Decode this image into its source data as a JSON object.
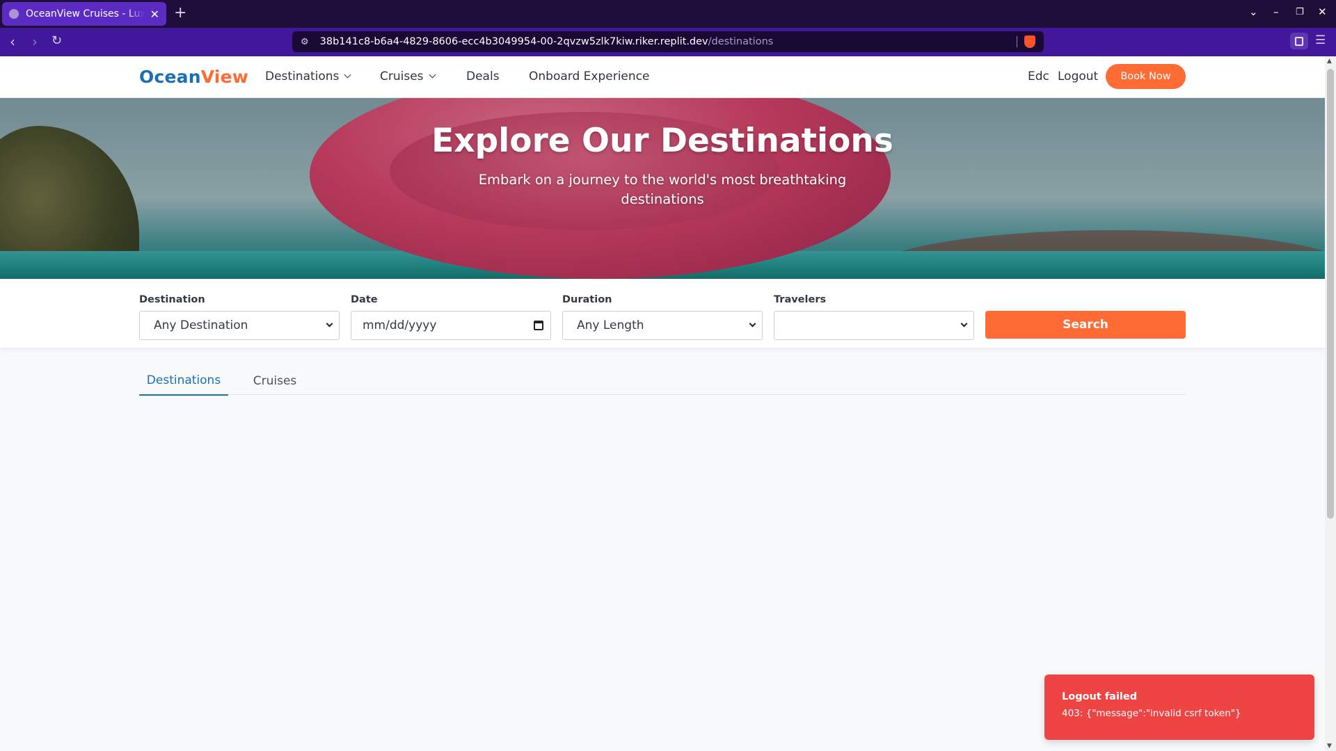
{
  "browser": {
    "tab_title": "OceanView Cruises - Luxury Cruises",
    "url_host": "38b141c8-b6a4-4829-8606-ecc4b3049954-00-2qvzw5zlk7kiw.riker.replit.dev",
    "url_path": "/destinations"
  },
  "nav": {
    "logo_part1": "Ocean",
    "logo_part2": "View",
    "links": [
      "Destinations",
      "Cruises",
      "Deals",
      "Onboard Experience"
    ],
    "user": "Edc",
    "logout": "Logout",
    "book_now": "Book Now"
  },
  "hero": {
    "title": "Explore Our Destinations",
    "subtitle": "Embark on a journey to the world's most breathtaking destinations"
  },
  "search": {
    "destination": {
      "label": "Destination",
      "value": "Any Destination"
    },
    "date": {
      "label": "Date",
      "value": "mm/dd/yyyy"
    },
    "duration": {
      "label": "Duration",
      "value": "Any Length"
    },
    "travelers": {
      "label": "Travelers",
      "value": ""
    },
    "button": "Search"
  },
  "tabs": [
    {
      "label": "Destinations",
      "active": true
    },
    {
      "label": "Cruises",
      "active": false
    }
  ],
  "toast": {
    "title": "Logout failed",
    "message": "403: {\"message\":\"invalid csrf token\"}"
  }
}
